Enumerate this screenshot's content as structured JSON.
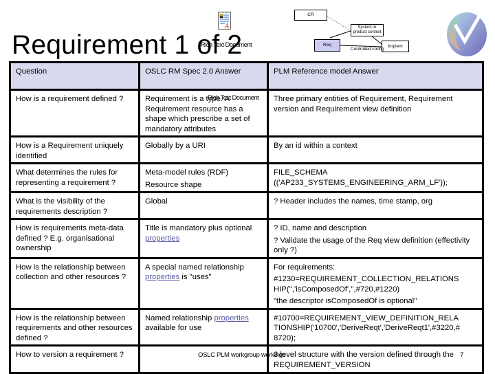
{
  "slide": {
    "title": "Requirement 1 of 2",
    "page_number": "7",
    "footer": "OSLC PLM workgroup workings"
  },
  "embedded_objects": [
    {
      "icon": "rtf-document-icon",
      "label": "Rich Text Document"
    },
    {
      "icon": "rtf-document-icon",
      "label": "Rich Text Document"
    }
  ],
  "diagram": {
    "nodes": [
      {
        "id": "cr",
        "label": "CR"
      },
      {
        "id": "system",
        "label": "System or product context"
      },
      {
        "id": "req",
        "label": "Req"
      },
      {
        "id": "implem",
        "label": "Implem"
      }
    ],
    "edge_labels": {
      "req_implem": "Controlled config"
    },
    "colors": {
      "req_fill": "#ccccf2",
      "dashed_edge": "#888888"
    }
  },
  "logo": {
    "icon": "oslc-logo-icon"
  },
  "table": {
    "headers": [
      "Question",
      "OSLC RM Spec 2.0 Answer",
      "PLM Reference model Answer"
    ],
    "rows": [
      {
        "question": "How is a requirement defined ?",
        "oslc": [
          "Requirement is a type. A Requirement resource has a shape which prescribe a set of mandatory attributes"
        ],
        "plm": [
          "Three primary entities of Requirement, Requirement version and Requirement view definition"
        ]
      },
      {
        "question": "How is a Requirement uniquely identified",
        "oslc": [
          "Globally by a URI"
        ],
        "plm": [
          "By an id within a context"
        ]
      },
      {
        "question": "What determines the rules for representing a requirement ?",
        "oslc": [
          "Meta-model rules (RDF)",
          "Resource shape"
        ],
        "plm": [
          "FILE_SCHEMA (('AP233_SYSTEMS_ENGINEERING_ARM_LF'));"
        ]
      },
      {
        "question": "What is the visibility of the requirements description ?",
        "oslc": [
          "Global"
        ],
        "plm": [
          "? Header includes the names, time stamp, org"
        ]
      },
      {
        "question": "How is requirements meta-data defined ? E.g. organisational ownership",
        "oslc_text": "Title is mandatory plus optional",
        "oslc_link": "properties",
        "plm": [
          "? ID, name and description",
          "? Validate the usage of the Req view definition (effectivity only ?)"
        ]
      },
      {
        "question": "How is the relationship between collection and other resources ?",
        "oslc_text": "A special named relationship",
        "oslc_link": "properties",
        "oslc_suffix": " is \"uses\"",
        "plm": [
          "For requirements:",
          "#1230=REQUIREMENT_COLLECTION_RELATIONS HIP('','isComposedOf','',#720,#1220)",
          "\"the descriptor isComposedOf is optional\""
        ]
      },
      {
        "question": "How is the relationship between requirements and other resources defined ?",
        "oslc_text": "Named relationship",
        "oslc_link": "properties",
        "oslc_suffix": "available for use",
        "plm": [
          "#10700=REQUIREMENT_VIEW_DEFINITION_RELA TIONSHIP('10700','DeriveReqt','DeriveReqt1',#3220,# 8720);"
        ]
      },
      {
        "question": "How to version a requirement ?",
        "oslc": [
          ""
        ],
        "plm": [
          "3 level structure with the version defined through the REQUIREMENT_VERSION"
        ]
      }
    ]
  }
}
